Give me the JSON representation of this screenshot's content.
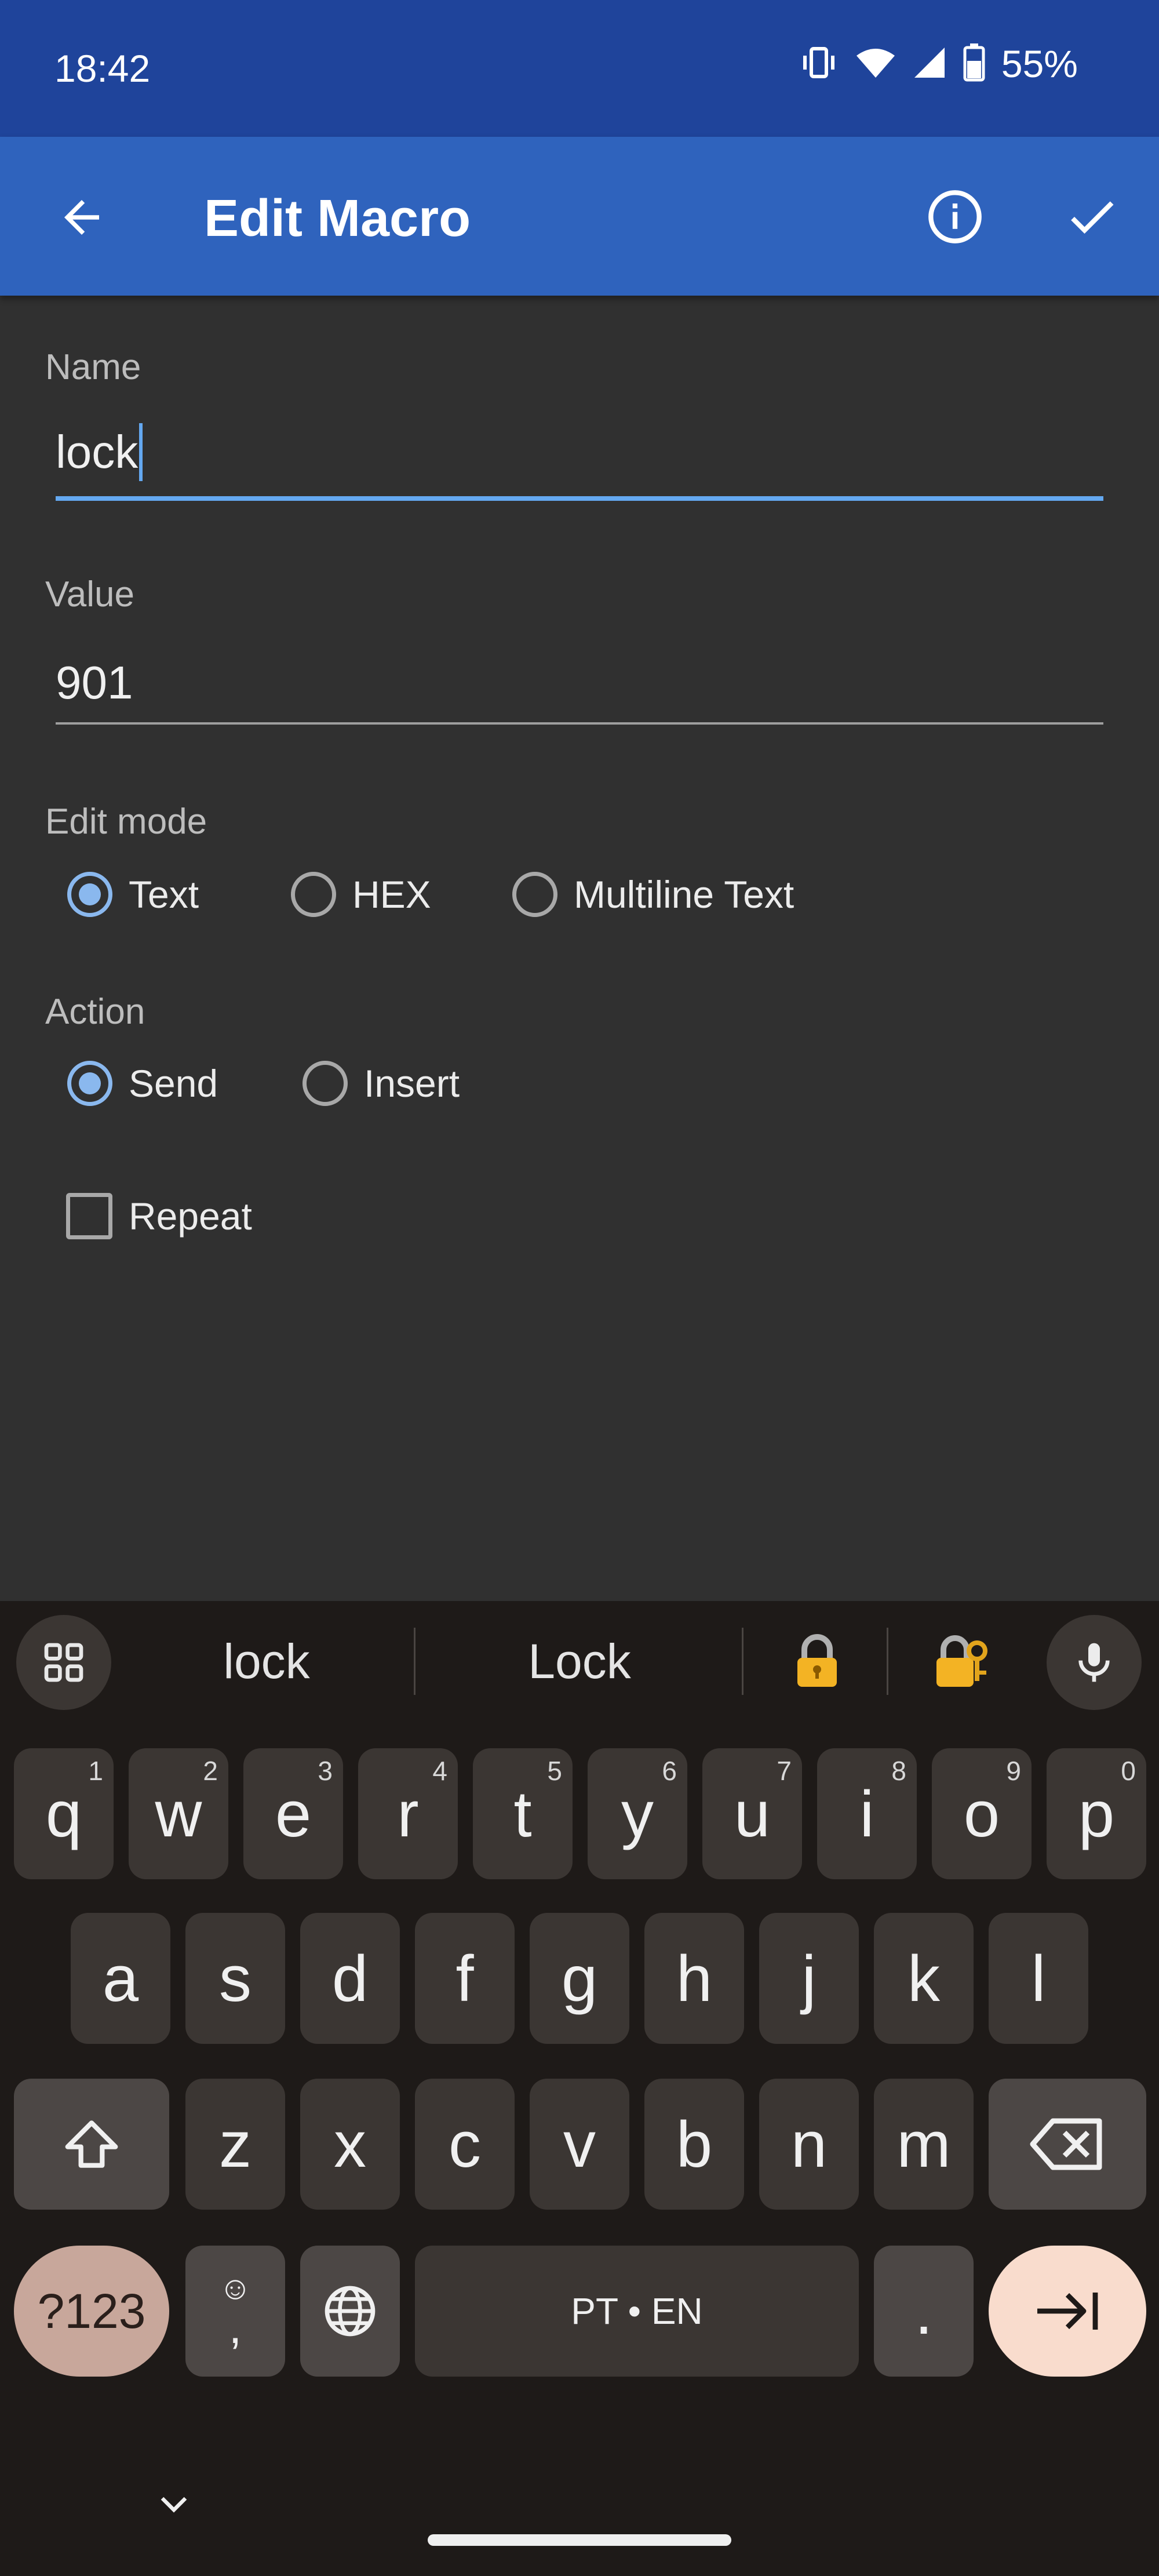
{
  "status_bar": {
    "time": "18:42",
    "battery": "55%",
    "icons": [
      "vibrate-icon",
      "wifi-icon",
      "signal-icon",
      "battery-icon"
    ]
  },
  "app_bar": {
    "title": "Edit Macro",
    "back_icon": "arrow-back-icon",
    "info_icon": "info-icon",
    "confirm_icon": "check-icon"
  },
  "form": {
    "name": {
      "label": "Name",
      "value": "lock"
    },
    "value": {
      "label": "Value",
      "value": "901"
    },
    "edit_mode": {
      "label": "Edit mode",
      "options": [
        "Text",
        "HEX",
        "Multiline Text"
      ],
      "selected": "Text"
    },
    "action": {
      "label": "Action",
      "options": [
        "Send",
        "Insert"
      ],
      "selected": "Send"
    },
    "repeat": {
      "label": "Repeat",
      "checked": false
    }
  },
  "keyboard": {
    "suggestions": [
      "lock",
      "Lock",
      "🔒",
      "🔐"
    ],
    "row1": [
      {
        "key": "q",
        "hint": "1"
      },
      {
        "key": "w",
        "hint": "2"
      },
      {
        "key": "e",
        "hint": "3"
      },
      {
        "key": "r",
        "hint": "4"
      },
      {
        "key": "t",
        "hint": "5"
      },
      {
        "key": "y",
        "hint": "6"
      },
      {
        "key": "u",
        "hint": "7"
      },
      {
        "key": "i",
        "hint": "8"
      },
      {
        "key": "o",
        "hint": "9"
      },
      {
        "key": "p",
        "hint": "0"
      }
    ],
    "row2": [
      "a",
      "s",
      "d",
      "f",
      "g",
      "h",
      "j",
      "k",
      "l"
    ],
    "row3": [
      "z",
      "x",
      "c",
      "v",
      "b",
      "n",
      "m"
    ],
    "symbols_label": "?123",
    "emoji_comma": {
      "top": "☺",
      "bottom": ","
    },
    "space_label": "PT • EN",
    "period": ".",
    "colors": {
      "background": "#1e1a18",
      "key": "#3b3633",
      "symbols_key": "#c8a79b",
      "enter_key": "#f9dccd"
    }
  },
  "colors": {
    "status_bar": "#1f449b",
    "app_bar": "#2f63bd",
    "accent": "#64a8f0",
    "background": "#303030"
  }
}
